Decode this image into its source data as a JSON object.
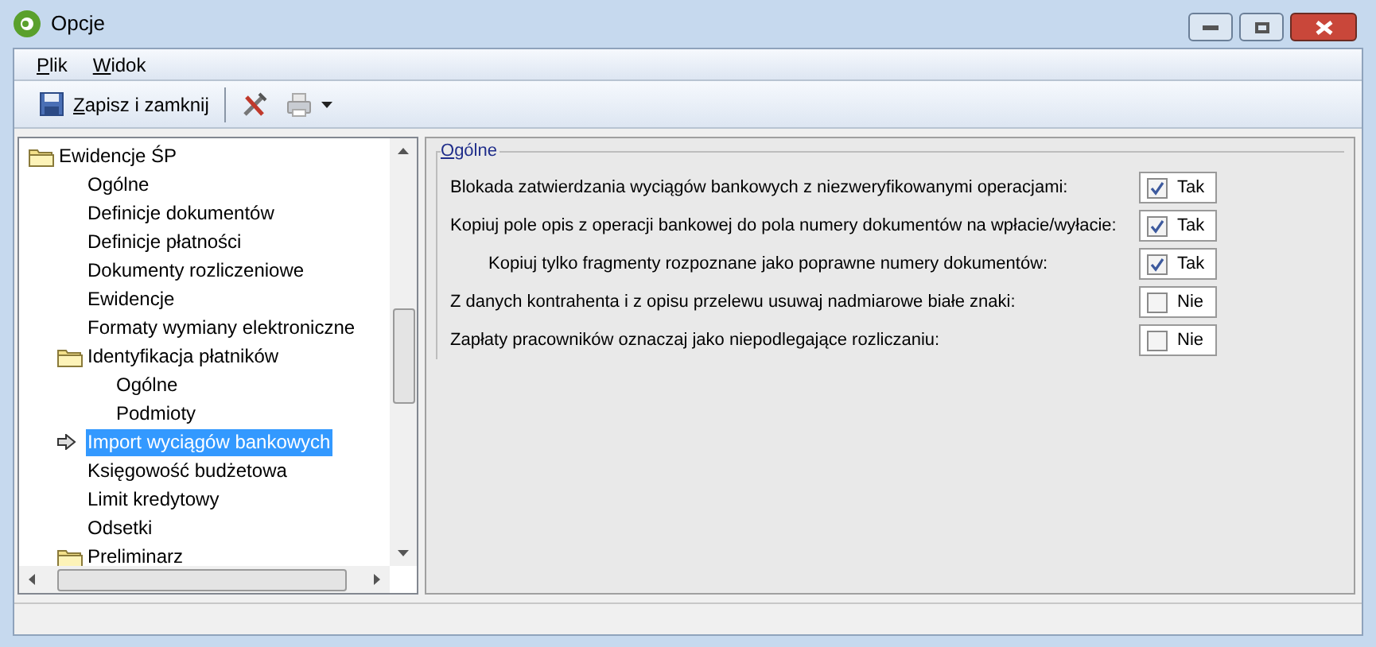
{
  "window": {
    "title": "Opcje"
  },
  "menu": [
    {
      "label": "Plik"
    },
    {
      "label": "Widok"
    }
  ],
  "toolbar": {
    "save_label": "Zapisz i zamknij"
  },
  "tree": [
    {
      "label": "Ewidencje ŚP",
      "kind": "folder",
      "selected": false,
      "children": [
        {
          "label": "Ogólne",
          "kind": "leaf",
          "selected": false
        },
        {
          "label": "Definicje dokumentów",
          "kind": "leaf",
          "selected": false
        },
        {
          "label": "Definicje płatności",
          "kind": "leaf",
          "selected": false
        },
        {
          "label": "Dokumenty rozliczeniowe",
          "kind": "leaf",
          "selected": false
        },
        {
          "label": "Ewidencje",
          "kind": "leaf",
          "selected": false
        },
        {
          "label": "Formaty wymiany elektroniczne",
          "kind": "leaf",
          "selected": false
        },
        {
          "label": "Identyfikacja płatników",
          "kind": "folder",
          "selected": false,
          "children": [
            {
              "label": "Ogólne",
              "kind": "leaf",
              "selected": false
            },
            {
              "label": "Podmioty",
              "kind": "leaf",
              "selected": false
            }
          ]
        },
        {
          "label": "Import wyciągów bankowych",
          "kind": "current",
          "selected": true
        },
        {
          "label": "Księgowość budżetowa",
          "kind": "leaf",
          "selected": false
        },
        {
          "label": "Limit kredytowy",
          "kind": "leaf",
          "selected": false
        },
        {
          "label": "Odsetki",
          "kind": "leaf",
          "selected": false
        },
        {
          "label": "Preliminarz",
          "kind": "folder",
          "selected": false
        }
      ]
    }
  ],
  "group": {
    "title": "Ogólne",
    "options": [
      {
        "label": "Blokada zatwierdzania wyciągów bankowych z niezweryfikowanymi operacjami:",
        "checked": true,
        "value": "Tak"
      },
      {
        "label": "Kopiuj pole opis z operacji bankowej do pola numery dokumentów na wpłacie/wyłacie:",
        "checked": true,
        "value": "Tak",
        "children": [
          {
            "label": "Kopiuj tylko fragmenty rozpoznane jako poprawne numery dokumentów:",
            "checked": true,
            "value": "Tak"
          }
        ]
      },
      {
        "label": "Z danych kontrahenta i z opisu przelewu usuwaj nadmiarowe białe znaki:",
        "checked": false,
        "value": "Nie"
      },
      {
        "label": "Zapłaty pracowników oznaczaj jako niepodlegające rozliczaniu:",
        "checked": false,
        "value": "Nie"
      }
    ]
  }
}
